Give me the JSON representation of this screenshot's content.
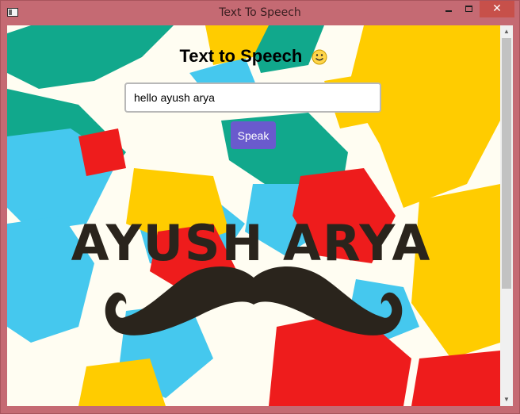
{
  "window": {
    "title": "Text To Speech",
    "minimize_glyph": "minimize-icon",
    "maximize_glyph": "maximize-icon",
    "close_glyph": "✕"
  },
  "page": {
    "heading": "Text to Speech",
    "heading_emoji": "smiley-icon",
    "input_value": "hello ayush arya",
    "speak_label": "Speak"
  },
  "background_art": {
    "logo_text": "AYUSH ARYA",
    "colors": {
      "teal": "#11a88c",
      "sky": "#45c8ee",
      "yellow": "#ffcc00",
      "red": "#ee1c1c",
      "dark": "#2a241c",
      "cream": "#fffdf2"
    }
  },
  "colors": {
    "window_frame": "#c56a73",
    "close_button": "#c7504a",
    "button_accent": "#6a5acd"
  },
  "scrollbar": {
    "up_glyph": "▲",
    "down_glyph": "▼"
  }
}
